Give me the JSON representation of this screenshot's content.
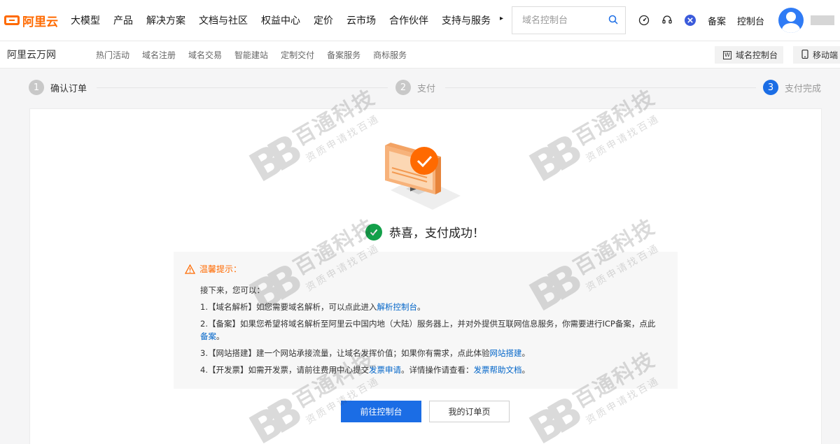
{
  "topnav": {
    "logo_text": "阿里云",
    "menu": [
      "大模型",
      "产品",
      "解决方案",
      "文档与社区",
      "权益中心",
      "定价",
      "云市场",
      "合作伙伴",
      "支持与服务"
    ],
    "more_glyph": "▸",
    "search_placeholder": "域名控制台",
    "right_links": {
      "beian": "备案",
      "console": "控制台"
    },
    "icons": [
      "dashboard-icon",
      "headset-icon",
      "plugin-icon"
    ]
  },
  "subnav": {
    "brand": "阿里云万网",
    "links": [
      "热门活动",
      "域名注册",
      "域名交易",
      "智能建站",
      "定制交付",
      "备案服务",
      "商标服务"
    ],
    "domain_console": "域名控制台",
    "mobile": "移动端"
  },
  "steps": [
    {
      "num": "1",
      "label": "确认订单"
    },
    {
      "num": "2",
      "label": "支付"
    },
    {
      "num": "3",
      "label": "支付完成"
    }
  ],
  "success_message": "恭喜，支付成功！",
  "tips": {
    "title": "温馨提示：",
    "intro": "接下来，您可以：",
    "item1_text": "1.【域名解析】如您需要域名解析，可以点此进入",
    "item1_link": "解析控制台",
    "item1_end": "。",
    "item2_text": "2.【备案】如果您希望将域名解析至阿里云中国内地（大陆）服务器上，并对外提供互联网信息服务，你需要进行ICP备案，点此",
    "item2_link": "备案",
    "item2_end": "。",
    "item3_text": "3.【网站搭建】建一个网站承接流量，让域名发挥价值；如果你有需求，点此体验",
    "item3_link": "网站搭建",
    "item3_end": "。",
    "item4_text": "4.【开发票】如需开发票，请前往费用中心提交",
    "item4_link1": "发票申请",
    "item4_mid": "。详情操作请查看：",
    "item4_link2": "发票帮助文档",
    "item4_end": "。"
  },
  "buttons": {
    "primary": "前往控制台",
    "secondary": "我的订单页"
  },
  "watermark": {
    "mark": "BB",
    "title": "百通科技",
    "subtitle": "资质申请找百通"
  },
  "colors": {
    "brand": "#ff6a00",
    "primary": "#1b6de5",
    "success": "#13a04a",
    "link": "#0064c8"
  }
}
